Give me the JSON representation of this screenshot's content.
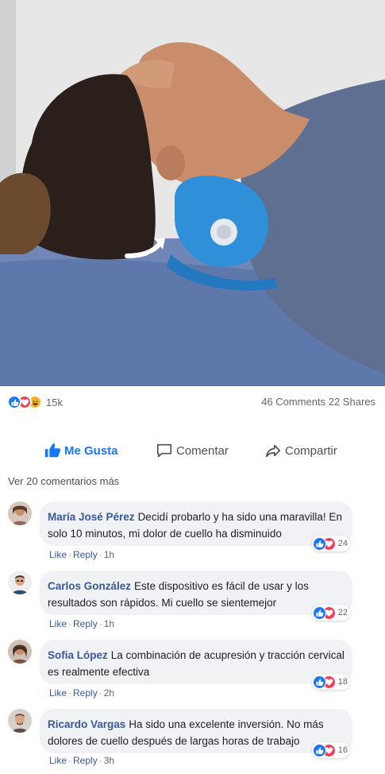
{
  "post": {
    "reactions": {
      "icons": [
        "like-icon",
        "love-icon",
        "haha-icon"
      ],
      "count": "15k"
    },
    "stats_text": "46 Comments 22 Shares"
  },
  "actions": {
    "like_label": "Me Gusta",
    "comment_label": "Comentar",
    "share_label": "Compartir"
  },
  "more_comments_label": "Ver 20 comentarios más",
  "comments": [
    {
      "name": "María José Pérez",
      "text": "Decidí probarlo y ha sido una maravilla! En solo 10 minutos, mi dolor de cuello ha disminuido",
      "reaction_count": "24",
      "like": "Like",
      "reply": "Reply",
      "time": "1h"
    },
    {
      "name": "Carlos González",
      "text": "Este dispositivo es fácil de usar y los resultados son rápidos. Mi cuello se sientemejor",
      "reaction_count": "22",
      "like": "Like",
      "reply": "Reply",
      "time": "1h"
    },
    {
      "name": "Sofia López",
      "text": "La combinación de acupresión y tracción cervical es realmente efectiva",
      "reaction_count": "18",
      "like": "Like",
      "reply": "Reply",
      "time": "2h"
    },
    {
      "name": "Ricardo Vargas",
      "text": "Ha sido una excelente inversión. No más dolores de cuello después de largas horas de trabajo",
      "reaction_count": "16",
      "like": "Like",
      "reply": "Reply",
      "time": "3h"
    }
  ],
  "colors": {
    "accent": "#1877f2",
    "love": "#f33e58",
    "haha": "#f7b125",
    "name_link": "#385898",
    "bubble_bg": "#f0f2f5",
    "pillow_blue": "#2f8fd8"
  }
}
